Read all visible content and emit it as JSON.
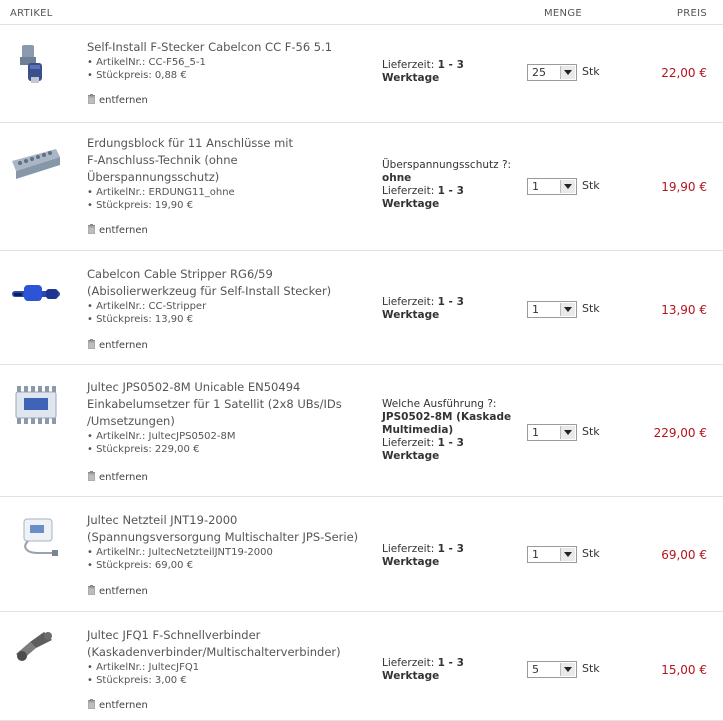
{
  "header": {
    "artikel": "ARTIKEL",
    "menge": "MENGE",
    "preis": "PREIS"
  },
  "remove_label": "entfernen",
  "unit_label": "Stk",
  "items": [
    {
      "title_lines": [
        "Self-Install F-Stecker Cabelcon CC F-56 5.1"
      ],
      "artnr": "• ArtikelNr.: CC-F56_5-1",
      "unitprice": "• Stückpreis: 0,88 €",
      "ship_lines": [
        {
          "t": "Lieferzeit: ",
          "b": "1 - 3"
        },
        {
          "t": "",
          "b": "Werktage"
        }
      ],
      "qty": "25",
      "price": "22,00 €"
    },
    {
      "title_lines": [
        "Erdungsblock für 11 Anschlüsse mit",
        "F-Anschluss-Technik (ohne",
        "Überspannungsschutz)"
      ],
      "artnr": "• ArtikelNr.: ERDUNG11_ohne",
      "unitprice": "• Stückpreis: 19,90 €",
      "ship_lines": [
        {
          "t": "Überspannungsschutz ?:",
          "b": ""
        },
        {
          "t": "",
          "b": "ohne"
        },
        {
          "t": "Lieferzeit: ",
          "b": "1 - 3"
        },
        {
          "t": "",
          "b": "Werktage"
        }
      ],
      "qty": "1",
      "price": "19,90 €"
    },
    {
      "title_lines": [
        "Cabelcon Cable Stripper RG6/59",
        "(Abisolierwerkzeug für Self-Install Stecker)"
      ],
      "artnr": "• ArtikelNr.: CC-Stripper",
      "unitprice": "• Stückpreis: 13,90 €",
      "ship_lines": [
        {
          "t": "Lieferzeit: ",
          "b": "1 - 3"
        },
        {
          "t": "",
          "b": "Werktage"
        }
      ],
      "qty": "1",
      "price": "13,90 €"
    },
    {
      "title_lines": [
        "Jultec JPS0502-8M Unicable EN50494",
        "Einkabelumsetzer für 1 Satellit (2x8 UBs/IDs",
        "/Umsetzungen)"
      ],
      "artnr": "• ArtikelNr.: JultecJPS0502-8M",
      "unitprice": "• Stückpreis: 229,00 €",
      "ship_lines": [
        {
          "t": "Welche Ausführung ?:",
          "b": ""
        },
        {
          "t": "",
          "b": "JPS0502-8M (Kaskade"
        },
        {
          "t": "",
          "b": "Multimedia)"
        },
        {
          "t": "Lieferzeit: ",
          "b": "1 - 3"
        },
        {
          "t": "",
          "b": "Werktage"
        }
      ],
      "qty": "1",
      "price": "229,00 €"
    },
    {
      "title_lines": [
        "Jultec Netzteil JNT19-2000",
        "(Spannungsversorgung Multischalter JPS-Serie)"
      ],
      "artnr": "• ArtikelNr.: JultecNetzteilJNT19-2000",
      "unitprice": "• Stückpreis: 69,00 €",
      "ship_lines": [
        {
          "t": "Lieferzeit: ",
          "b": "1 - 3"
        },
        {
          "t": "",
          "b": "Werktage"
        }
      ],
      "qty": "1",
      "price": "69,00 €"
    },
    {
      "title_lines": [
        "Jultec JFQ1 F-Schnellverbinder",
        "(Kaskadenverbinder/Multischalterverbinder)"
      ],
      "artnr": "• ArtikelNr.: JultecJFQ1",
      "unitprice": "• Stückpreis: 3,00 €",
      "ship_lines": [
        {
          "t": "Lieferzeit: ",
          "b": "1 - 3"
        },
        {
          "t": "",
          "b": "Werktage"
        }
      ],
      "qty": "5",
      "price": "15,00 €"
    }
  ],
  "icons": [
    "connector-image",
    "grounding-block-image",
    "cable-stripper-image",
    "multiswitch-image",
    "power-supply-image",
    "quick-connector-image",
    "trash-icon"
  ]
}
